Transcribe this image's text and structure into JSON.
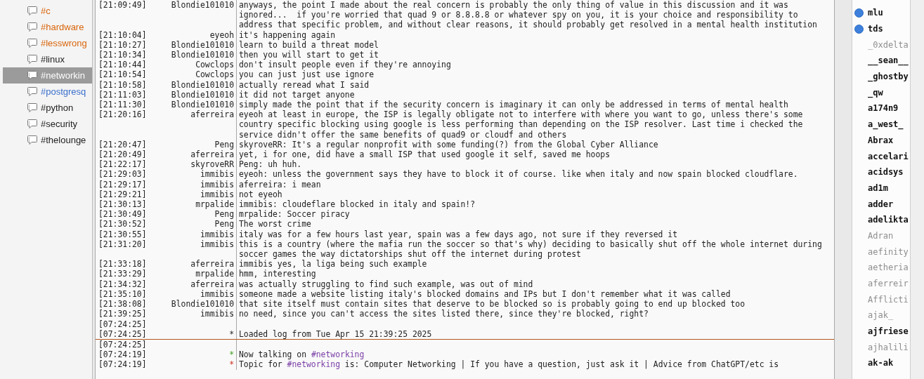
{
  "channels": [
    {
      "name": "#c",
      "selected": false,
      "color": "#d9650b"
    },
    {
      "name": "#hardware",
      "selected": false,
      "color": "#d9650b"
    },
    {
      "name": "#lesswrong",
      "selected": false,
      "color": "#d9650b"
    },
    {
      "name": "#linux",
      "selected": false,
      "color": "#222222"
    },
    {
      "name": "#networkin",
      "selected": true
    },
    {
      "name": "#postgresq",
      "selected": false,
      "color": "#3a6ecb"
    },
    {
      "name": "#python",
      "selected": false,
      "color": "#222222"
    },
    {
      "name": "#security",
      "selected": false,
      "color": "#222222"
    },
    {
      "name": "#thelounge",
      "selected": false,
      "color": "#222222"
    }
  ],
  "messages": [
    {
      "kind": "message",
      "time": "[21:09:49]",
      "nick": "Blondie101010",
      "text": "anyways, the point I made about the real concern is probably the only thing of value in this discussion and it was ignored...  if you're worried that quad 9 or 8.8.8.8 or whatever spy on you, it is your choice and responsibility to address that specific problem, and without clear reasons, it should probably get resolved in a mental health institution"
    },
    {
      "kind": "message",
      "time": "[21:10:04]",
      "nick": "eyeoh",
      "text": "it's happening again"
    },
    {
      "kind": "message",
      "time": "[21:10:27]",
      "nick": "Blondie101010",
      "text": "learn to build a threat model"
    },
    {
      "kind": "message",
      "time": "[21:10:34]",
      "nick": "Blondie101010",
      "text": "then you will start to get it"
    },
    {
      "kind": "message",
      "time": "[21:10:44]",
      "nick": "Cowclops",
      "text": "don't insult people even if they're annoying"
    },
    {
      "kind": "message",
      "time": "[21:10:54]",
      "nick": "Cowclops",
      "text": "you can just just use ignore"
    },
    {
      "kind": "message",
      "time": "[21:10:58]",
      "nick": "Blondie101010",
      "text": "actually reread what I said"
    },
    {
      "kind": "message",
      "time": "[21:11:03]",
      "nick": "Blondie101010",
      "text": "it did not target anyone"
    },
    {
      "kind": "message",
      "time": "[21:11:30]",
      "nick": "Blondie101010",
      "text": "simply made the point that if the security concern is imaginary it can only be addressed in terms of mental health"
    },
    {
      "kind": "message",
      "time": "[21:20:16]",
      "nick": "aferreira",
      "text": "eyeoh at least in europe, the ISP is legally obligate not to interfere with where you want to go, unless there's some country specific blocking using google is less performing than depending on the ISP resolver. Last time i checked the service didn't offer the same benefits of quad9 or cloudf and others"
    },
    {
      "kind": "message",
      "time": "[21:20:47]",
      "nick": "Peng",
      "text": "skyroveRR: It's a regular nonprofit with some funding(?) from the Global Cyber Alliance"
    },
    {
      "kind": "message",
      "time": "[21:20:49]",
      "nick": "aferreira",
      "text": "yet, i for one, did have a small ISP that used google it self, saved me hoops"
    },
    {
      "kind": "message",
      "time": "[21:22:17]",
      "nick": "skyroveRR",
      "text": "Peng: uh huh."
    },
    {
      "kind": "message",
      "time": "[21:29:03]",
      "nick": "immibis",
      "text": "eyeoh: unless the government says they have to block it of course. like when italy and now spain blocked cloudflare."
    },
    {
      "kind": "message",
      "time": "[21:29:17]",
      "nick": "immibis",
      "text": "aferreira: i mean"
    },
    {
      "kind": "message",
      "time": "[21:29:21]",
      "nick": "immibis",
      "text": "not eyeoh"
    },
    {
      "kind": "message",
      "time": "[21:30:13]",
      "nick": "mrpalide",
      "text": "immibis: cloudeflare blocked in italy and spain!?"
    },
    {
      "kind": "message",
      "time": "[21:30:49]",
      "nick": "Peng",
      "text": "mrpalide: Soccer piracy"
    },
    {
      "kind": "message",
      "time": "[21:30:52]",
      "nick": "Peng",
      "text": "The worst crime"
    },
    {
      "kind": "message",
      "time": "[21:30:55]",
      "nick": "immibis",
      "text": "italy was for a few hours last year, spain was a few days ago, not sure if they reversed it"
    },
    {
      "kind": "message",
      "time": "[21:31:20]",
      "nick": "immibis",
      "text": "this is a country (where the mafia run the soccer so that's why) deciding to basically shut off the whole internet during soccer games the way dictatorships shut off the internet during protest"
    },
    {
      "kind": "message",
      "time": "[21:33:18]",
      "nick": "aferreira",
      "text": "immibis yes, la liga being such example"
    },
    {
      "kind": "message",
      "time": "[21:33:29]",
      "nick": "mrpalide",
      "text": "hmm, interesting"
    },
    {
      "kind": "message",
      "time": "[21:34:32]",
      "nick": "aferreira",
      "text": "was actually struggling to find such example, was out of mind"
    },
    {
      "kind": "message",
      "time": "[21:35:10]",
      "nick": "immibis",
      "text": "someone made a website listing italy's blocked domains and IPs but I don't remember what it was called"
    },
    {
      "kind": "message",
      "time": "[21:38:08]",
      "nick": "Blondie101010",
      "text": "that site itself must contain sites that deserve to be blocked so is probably going to end up blocked too"
    },
    {
      "kind": "message",
      "time": "[21:39:25]",
      "nick": "immibis",
      "text": "no need, since you can't access the sites listed there, since they're blocked, right?"
    },
    {
      "kind": "message",
      "time": "[07:24:25]"
    },
    {
      "kind": "log",
      "time": "[07:24:25]",
      "nick": "*",
      "text": "Loaded log from Tue Apr 15 21:39:25 2025"
    },
    {
      "kind": "marker"
    },
    {
      "kind": "message",
      "time": "[07:24:25]"
    },
    {
      "kind": "join",
      "time": "[07:24:19]",
      "nick": "*",
      "text": [
        {
          "kind": "plain",
          "text": "Now talking on "
        },
        {
          "kind": "channel",
          "text": "#networking"
        }
      ]
    },
    {
      "kind": "topic",
      "time": "[07:24:19]",
      "nick": "*",
      "text": [
        {
          "kind": "plain",
          "text": "Topic for "
        },
        {
          "kind": "channel",
          "text": "#networking"
        },
        {
          "kind": "plain",
          "text": " is: Computer Networking | If you have a question, just ask it | Advice from ChatGPT/etc is"
        }
      ]
    }
  ],
  "users": [
    {
      "name": "mlu",
      "op": true,
      "away": false
    },
    {
      "name": "tds",
      "op": true,
      "away": false
    },
    {
      "name": "_0xdelta",
      "op": false,
      "away": true
    },
    {
      "name": "__sean__",
      "op": false,
      "away": false
    },
    {
      "name": "_ghostby",
      "op": false,
      "away": false
    },
    {
      "name": "_qw",
      "op": false,
      "away": false
    },
    {
      "name": "a174n9",
      "op": false,
      "away": false
    },
    {
      "name": "a_west_",
      "op": false,
      "away": false
    },
    {
      "name": "Abrax",
      "op": false,
      "away": false
    },
    {
      "name": "accelari",
      "op": false,
      "away": false
    },
    {
      "name": "acidsys",
      "op": false,
      "away": false
    },
    {
      "name": "ad1m",
      "op": false,
      "away": false
    },
    {
      "name": "adder",
      "op": false,
      "away": false
    },
    {
      "name": "adelikta",
      "op": false,
      "away": false
    },
    {
      "name": "Adran",
      "op": false,
      "away": true
    },
    {
      "name": "aefinity",
      "op": false,
      "away": true
    },
    {
      "name": "aetheria",
      "op": false,
      "away": true
    },
    {
      "name": "aferreir",
      "op": false,
      "away": true
    },
    {
      "name": "Afflicti",
      "op": false,
      "away": true
    },
    {
      "name": "ajak_",
      "op": false,
      "away": true
    },
    {
      "name": "ajfriese",
      "op": false,
      "away": false
    },
    {
      "name": "ajhalili",
      "op": false,
      "away": true
    },
    {
      "name": "ak-ak",
      "op": false,
      "away": false
    }
  ]
}
